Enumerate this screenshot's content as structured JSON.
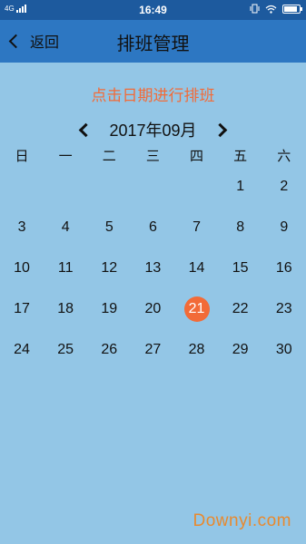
{
  "status_bar": {
    "network": "4G",
    "time": "16:49",
    "battery_level": 0.8,
    "icons": [
      "signal-icon",
      "vibrate-icon",
      "wifi-icon",
      "battery-icon"
    ]
  },
  "nav": {
    "back_label": "返回",
    "title": "排班管理"
  },
  "hint": "点击日期进行排班",
  "calendar": {
    "month_label": "2017年09月",
    "weekdays": [
      "日",
      "一",
      "二",
      "三",
      "四",
      "五",
      "六"
    ],
    "first_weekday_index": 5,
    "days": [
      "1",
      "2",
      "3",
      "4",
      "5",
      "6",
      "7",
      "8",
      "9",
      "10",
      "11",
      "12",
      "13",
      "14",
      "15",
      "16",
      "17",
      "18",
      "19",
      "20",
      "21",
      "22",
      "23",
      "24",
      "25",
      "26",
      "27",
      "28",
      "29",
      "30"
    ],
    "selected_day": "21"
  },
  "colors": {
    "background": "#93c6e6",
    "nav_bar": "#2d77c2",
    "status_bar": "#1d5a9e",
    "accent": "#f26b38"
  },
  "watermark": "Downyi.com"
}
